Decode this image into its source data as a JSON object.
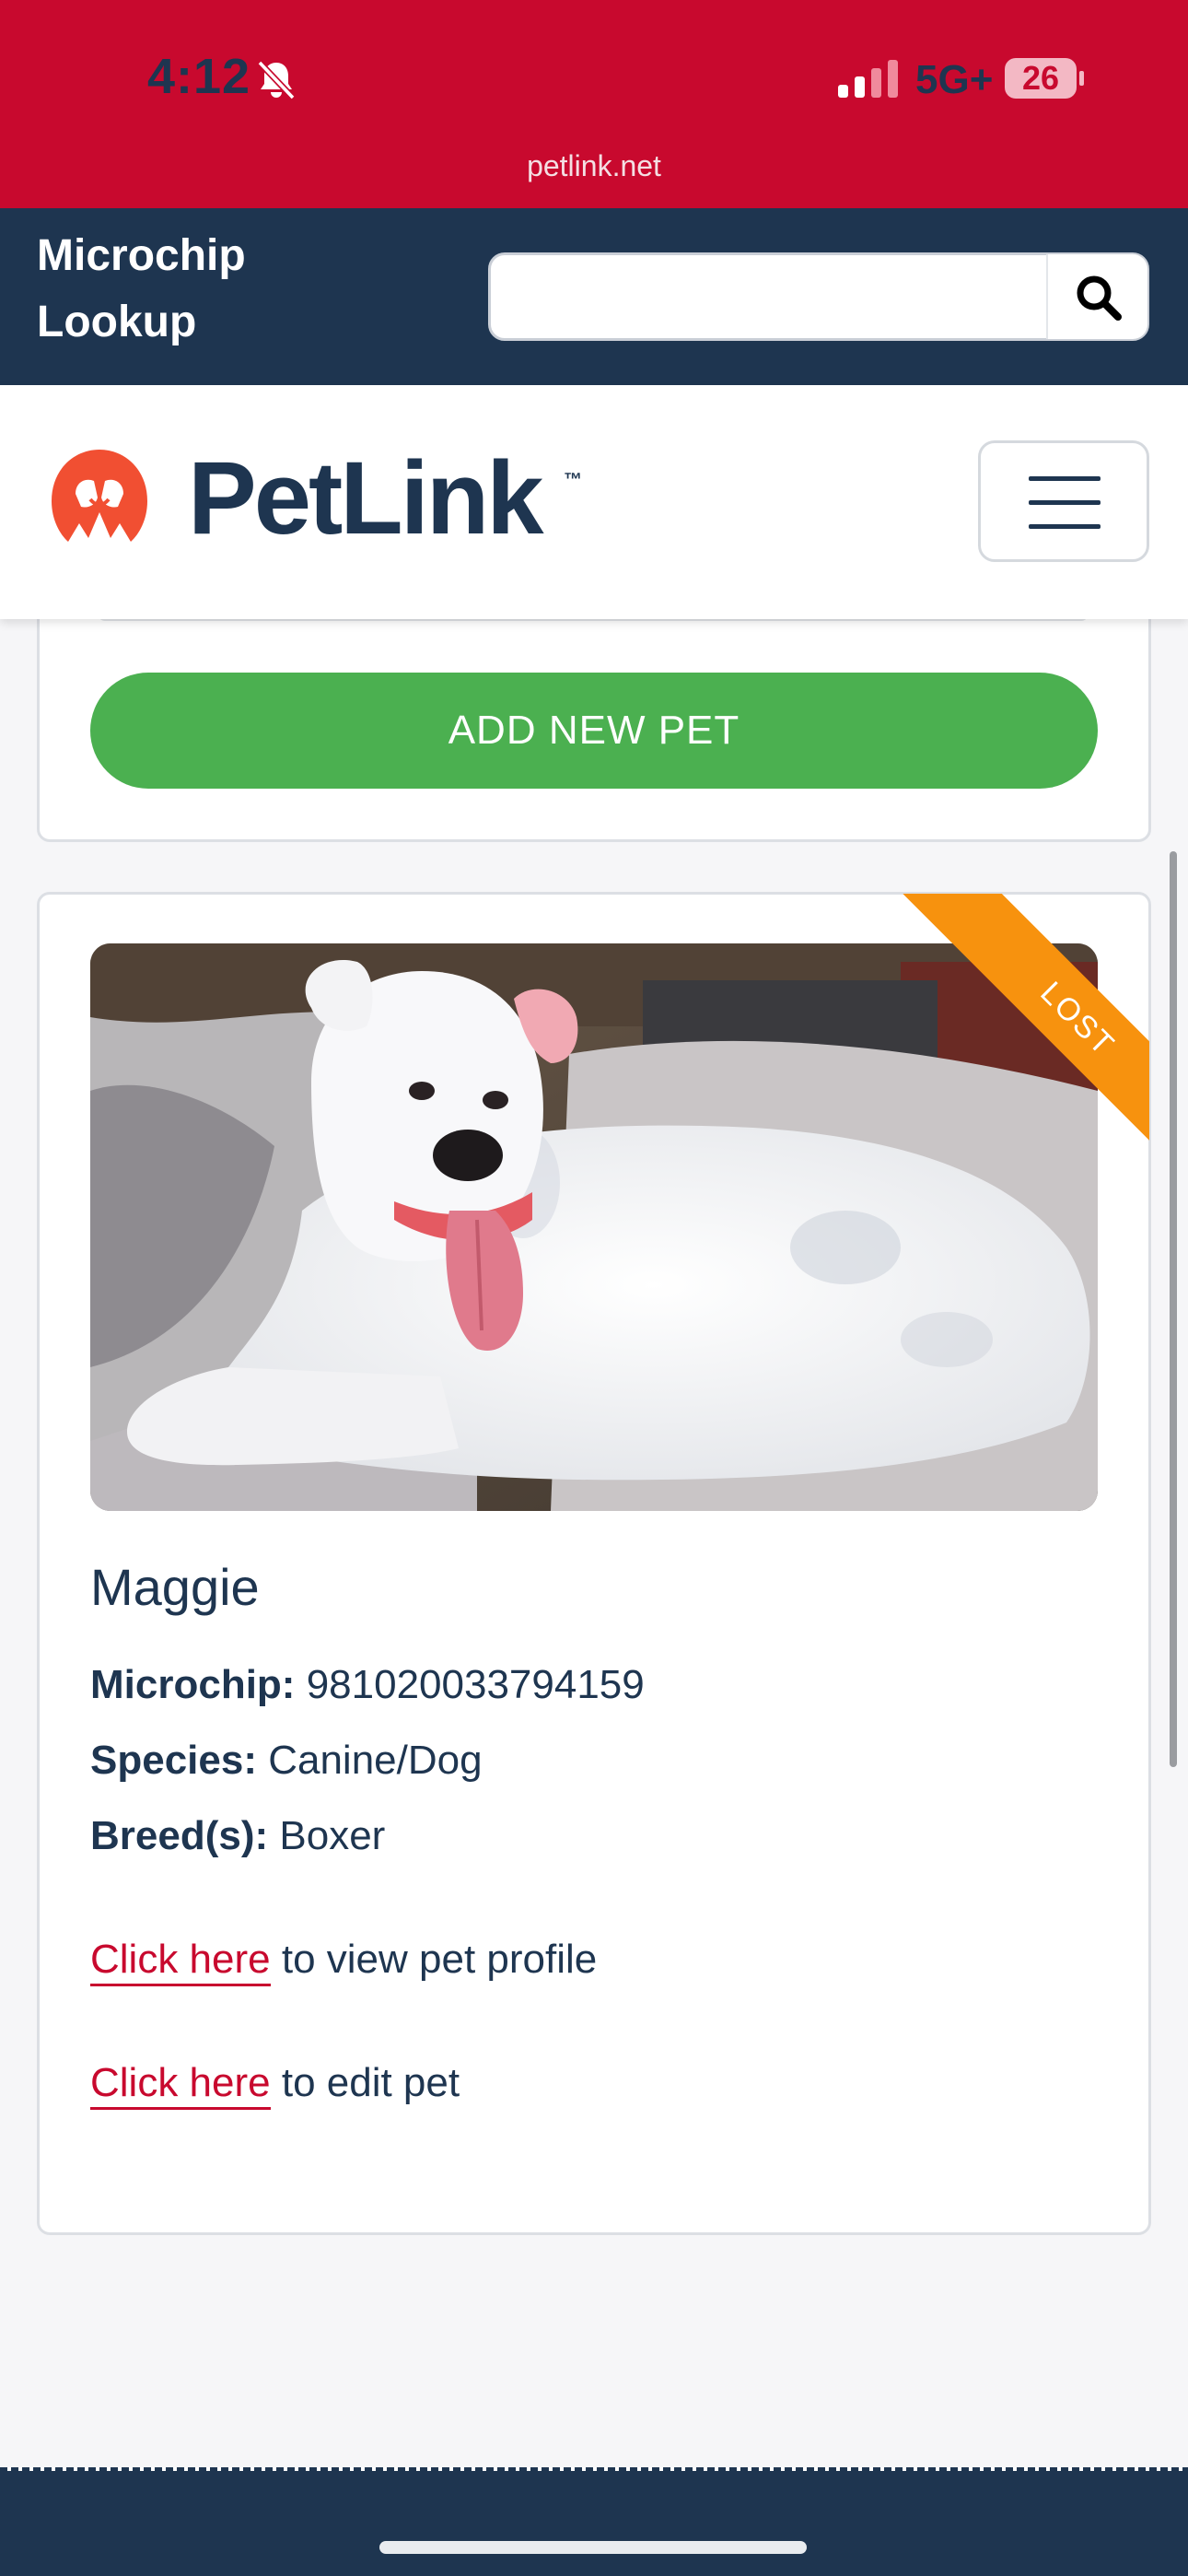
{
  "status_bar": {
    "time": "4:12",
    "network": "5G+",
    "battery": "26",
    "url": "petlink.net"
  },
  "lookup": {
    "title": "Microchip Lookup",
    "search_value": "",
    "search_placeholder": ""
  },
  "header": {
    "brand": "PetLink",
    "trademark": "™"
  },
  "actions": {
    "add_pet_label": "ADD NEW PET"
  },
  "pet": {
    "status_ribbon": "LOST",
    "name": "Maggie",
    "microchip_label": "Microchip:",
    "microchip": "981020033794159",
    "species_label": "Species:",
    "species": "Canine/Dog",
    "breed_label": "Breed(s):",
    "breed": "Boxer",
    "profile_link": "Click here",
    "profile_text": " to view pet profile",
    "edit_link": "Click here",
    "edit_text": " to edit pet"
  },
  "colors": {
    "brand_red": "#c8092e",
    "navy": "#1e3550",
    "green": "#4bb050",
    "orange": "#f7920e"
  }
}
